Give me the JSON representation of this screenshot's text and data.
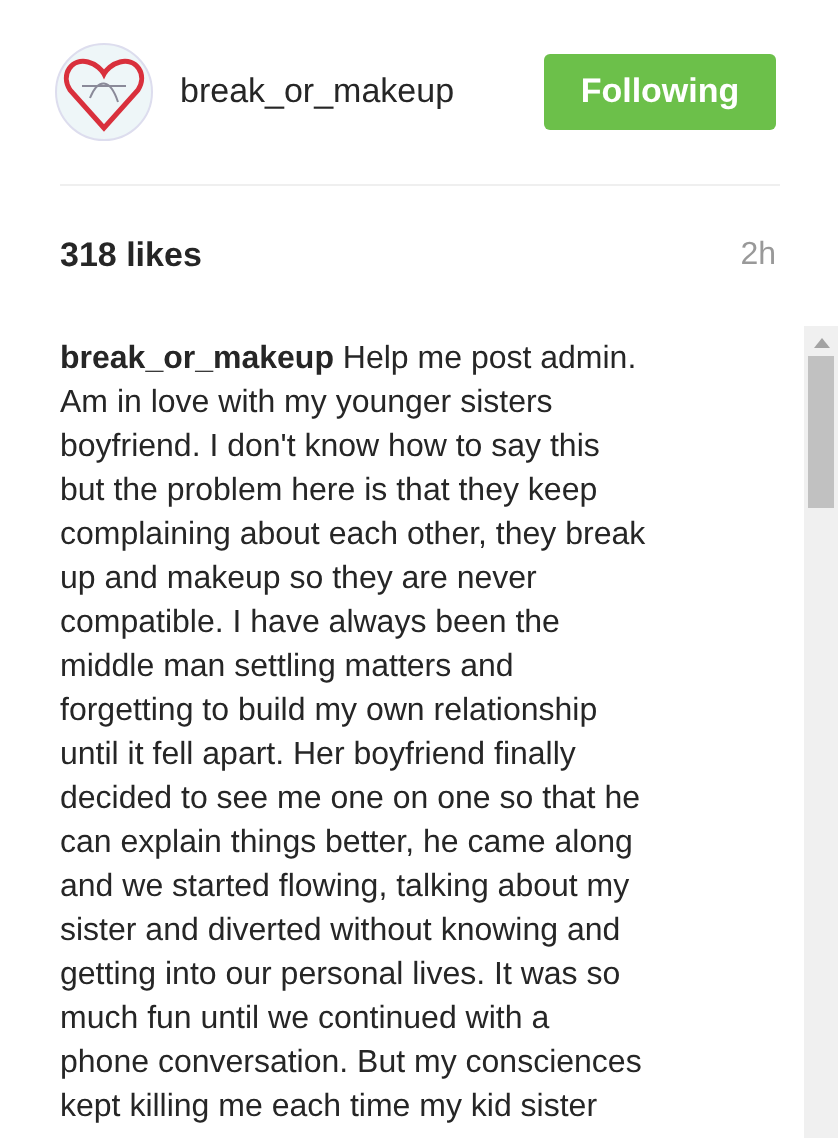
{
  "header": {
    "username": "break_or_makeup",
    "follow_button": {
      "label": "Following",
      "selected": true
    }
  },
  "likes": "318 likes",
  "time": "2h",
  "caption": {
    "lines": [
      "**break_or_makeup** Help me post admin.",
      "Am in love with my younger sisters",
      "boyfriend. I don't know how to say this",
      "but the problem here is that they keep",
      "complaining about each other, they break",
      "up and makeup so they are never",
      "compatible. I have always been the",
      "middle man settling matters and",
      "forgetting to build my own relationship",
      "until it fell apart. Her boyfriend finally",
      "decided to see me one on one so that he",
      "can explain things better, he came along",
      "and we started flowing, talking about my",
      "sister and diverted without knowing and",
      "getting into our personal lives. It was so",
      "much fun until we continued with a",
      "phone conversation. But my consciences",
      "kept killing me each time my kid sister"
    ]
  }
}
